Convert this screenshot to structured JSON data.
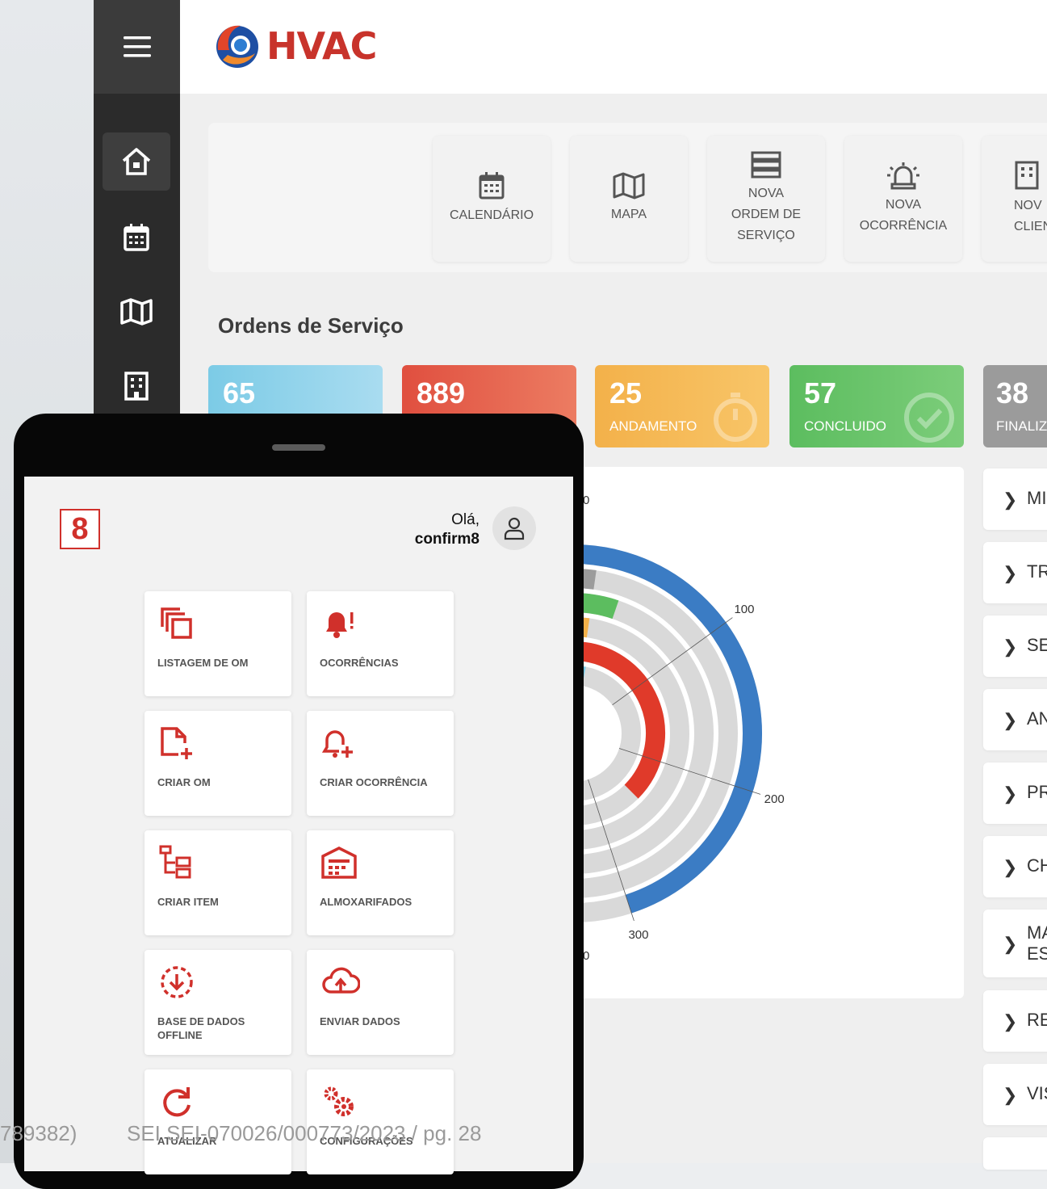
{
  "brand": {
    "logo_text": "HVAC"
  },
  "sidebar": {
    "items": [
      "home-icon",
      "calendar-icon",
      "map-icon",
      "building-icon"
    ]
  },
  "shortcuts": [
    {
      "label": "CALENDÁRIO",
      "icon": "calendar-icon"
    },
    {
      "label": "MAPA",
      "icon": "map-icon"
    },
    {
      "label": "NOVA ORDEM DE SERVIÇO",
      "icon": "server-icon"
    },
    {
      "label": "NOVA OCORRÊNCIA",
      "icon": "siren-icon"
    },
    {
      "label": "NOV CLIEN",
      "icon": "building-icon"
    }
  ],
  "section_title": "Ordens de Serviço",
  "stats": [
    {
      "value": "65",
      "label": "",
      "color": "#7ccbe6"
    },
    {
      "value": "889",
      "label": "",
      "color": "#e04f3f"
    },
    {
      "value": "25",
      "label": "ANDAMENTO",
      "color": "#f3b14a"
    },
    {
      "value": "57",
      "label": "CONCLUIDO",
      "color": "#5cbd5f"
    },
    {
      "value": "38",
      "label": "FINALIZ",
      "color": "#9b9b9b"
    }
  ],
  "chart_data": {
    "type": "radial-bar",
    "axis_ticks": [
      "100",
      "200",
      "300",
      "400",
      "500"
    ],
    "axis_max": 500,
    "series": [
      {
        "value": 300,
        "color": "#3b7cc4"
      },
      {
        "value": 15,
        "color": "#9b9b9b"
      },
      {
        "value": 35,
        "color": "#5cbd5f"
      },
      {
        "value": 15,
        "color": "#f3b14a"
      },
      {
        "value": 250,
        "color": "#e03a2a"
      },
      {
        "value": 20,
        "color": "#7ccbe6"
      }
    ],
    "partial_labels": [
      "0",
      "0"
    ]
  },
  "accordion": [
    {
      "label": "MI"
    },
    {
      "label": "TR"
    },
    {
      "label": "SE"
    },
    {
      "label": "AN"
    },
    {
      "label": "PR"
    },
    {
      "label": "CH"
    },
    {
      "label": "MA ES"
    },
    {
      "label": "RE"
    },
    {
      "label": "VIS"
    }
  ],
  "phone": {
    "app_logo": "8",
    "greeting": "Olá,",
    "username": "confirm8",
    "tiles": [
      {
        "label": "LISTAGEM DE OM",
        "icon": "copy-icon"
      },
      {
        "label": "OCORRÊNCIAS",
        "icon": "bell-alert-icon"
      },
      {
        "label": "CRIAR OM",
        "icon": "file-add-icon"
      },
      {
        "label": "CRIAR OCORRÊNCIA",
        "icon": "bell-add-icon"
      },
      {
        "label": "CRIAR ITEM",
        "icon": "tree-icon"
      },
      {
        "label": "ALMOXARIFADOS",
        "icon": "warehouse-icon"
      },
      {
        "label": "BASE DE DADOS OFFLINE",
        "icon": "download-circle-icon"
      },
      {
        "label": "ENVIAR DADOS",
        "icon": "cloud-upload-icon"
      },
      {
        "label": "ATUALIZAR",
        "icon": "refresh-icon"
      },
      {
        "label": "CONFIGURAÇÕES",
        "icon": "gears-icon"
      }
    ]
  },
  "footer": {
    "left": "789382)",
    "right": "SEI SEI-070026/000773/2023 / pg. 28"
  },
  "colors": {
    "accent": "#d0302b",
    "sidebar": "#2b2b2b"
  }
}
